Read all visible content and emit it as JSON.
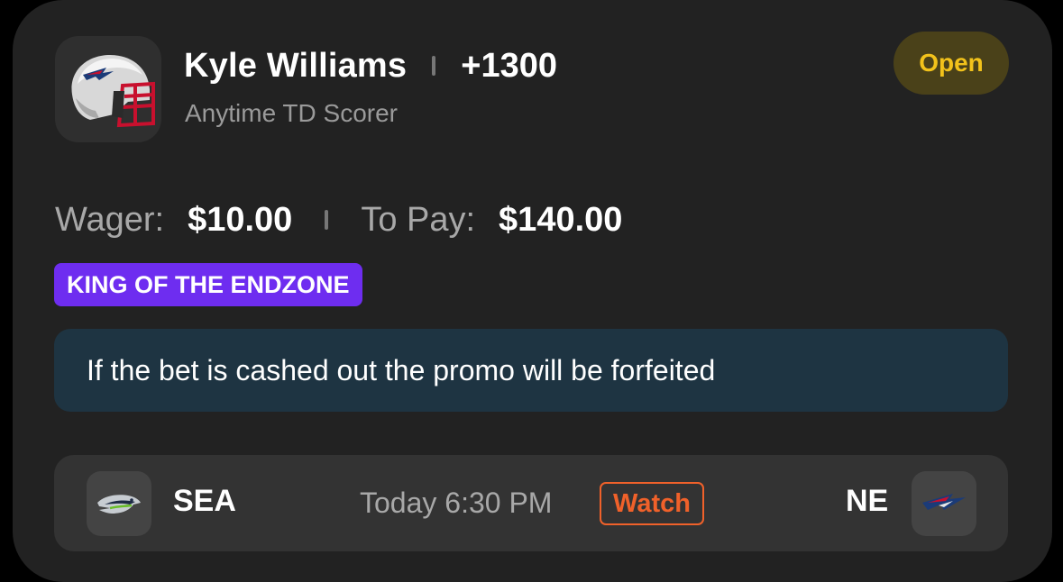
{
  "bet": {
    "player_name": "Kyle Williams",
    "odds": "+1300",
    "market": "Anytime TD Scorer",
    "status": "Open",
    "player_icon": "patriots-helmet-icon"
  },
  "amounts": {
    "wager_label": "Wager:",
    "wager_value": "$10.00",
    "topay_label": "To Pay:",
    "topay_value": "$140.00"
  },
  "promo": {
    "badge": "KING OF THE ENDZONE",
    "notice": "If the bet is cashed out the promo will be forfeited"
  },
  "game": {
    "away_team": "SEA",
    "away_icon": "seahawks-logo-icon",
    "time": "Today 6:30 PM",
    "watch_label": "Watch",
    "home_team": "NE",
    "home_icon": "patriots-logo-icon"
  },
  "colors": {
    "card_bg": "#222222",
    "status_text": "#f2c21b",
    "status_bg": "#4a4119",
    "promo_badge": "#6e2df0",
    "info_bg": "#1e3442",
    "watch_accent": "#f0612a"
  }
}
